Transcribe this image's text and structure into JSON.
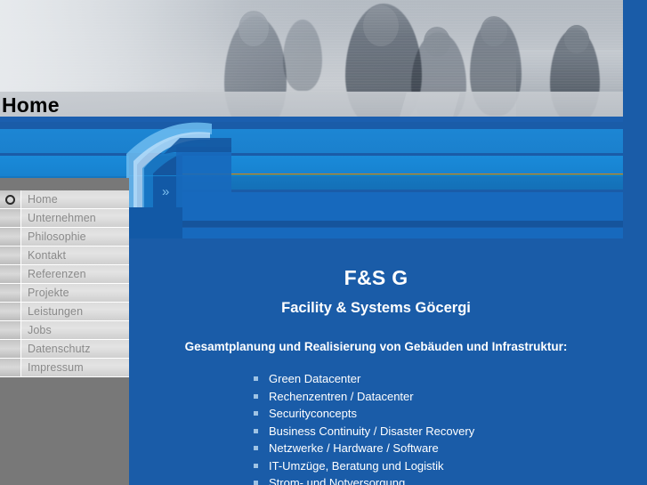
{
  "page": {
    "title": "Home",
    "background_color": "#1a5ca8"
  },
  "banner": {
    "chevron_icon": "»",
    "accent_line_color": "#d98317"
  },
  "sidebar": {
    "items": [
      {
        "label": "Home",
        "icon": "ring-icon",
        "active": true
      },
      {
        "label": "Unternehmen",
        "icon": "",
        "active": false
      },
      {
        "label": "Philosophie",
        "icon": "",
        "active": false
      },
      {
        "label": "Kontakt",
        "icon": "",
        "active": false
      },
      {
        "label": "Referenzen",
        "icon": "",
        "active": false
      },
      {
        "label": "Projekte",
        "icon": "",
        "active": false
      },
      {
        "label": "Leistungen",
        "icon": "",
        "active": false
      },
      {
        "label": "Jobs",
        "icon": "",
        "active": false
      },
      {
        "label": "Datenschutz",
        "icon": "",
        "active": false
      },
      {
        "label": "Impressum",
        "icon": "",
        "active": false
      }
    ]
  },
  "content": {
    "brand_title": "F&S G",
    "brand_subtitle": "Facility & Systems Göcergi",
    "tagline": "Gesamtplanung und Realisierung von Gebäuden und Infrastruktur:",
    "services": [
      "Green Datacenter",
      "Rechenzentren / Datacenter",
      "Securityconcepts",
      "Business Continuity / Disaster Recovery",
      "Netzwerke / Hardware / Software",
      "IT-Umzüge, Beratung und Logistik",
      "Strom- und Notversorgung"
    ],
    "bullet_color": "#9fc3e4"
  }
}
